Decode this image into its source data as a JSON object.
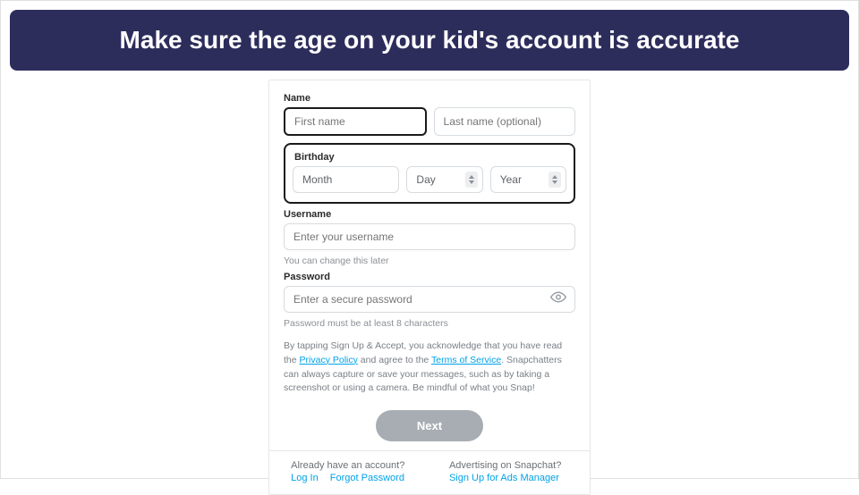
{
  "banner": "Make sure the age on your kid's account is accurate",
  "form": {
    "name": {
      "label": "Name",
      "first_placeholder": "First name",
      "last_placeholder": "Last name (optional)"
    },
    "birthday": {
      "label": "Birthday",
      "month_placeholder": "Month",
      "day_placeholder": "Day",
      "year_placeholder": "Year"
    },
    "username": {
      "label": "Username",
      "placeholder": "Enter your username",
      "helper": "You can change this later"
    },
    "password": {
      "label": "Password",
      "placeholder": "Enter a secure password",
      "helper": "Password must be at least 8 characters"
    },
    "legal": {
      "prefix": "By tapping Sign Up & Accept, you acknowledge that you have read the ",
      "privacy": "Privacy Policy",
      "mid": " and agree to the ",
      "terms": "Terms of Service",
      "suffix": ". Snapchatters can always capture or save your messages, such as by taking a screenshot or using a camera. Be mindful of what you Snap!"
    },
    "next_label": "Next",
    "footer": {
      "left_q": "Already have an account?",
      "login": "Log In",
      "forgot": "Forgot Password",
      "right_q": "Advertising on Snapchat?",
      "ads": "Sign Up for Ads Manager"
    }
  }
}
